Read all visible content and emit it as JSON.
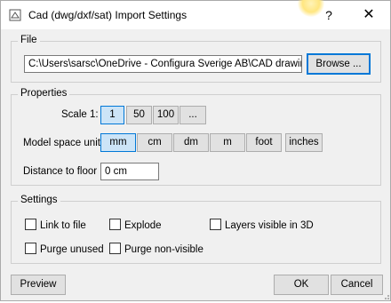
{
  "window": {
    "title": "Cad (dwg/dxf/sat) Import Settings",
    "help_label": "?",
    "close_label": "✕"
  },
  "file": {
    "group_label": "File",
    "path_value": "C:\\Users\\sarsc\\OneDrive - Configura Sverige AB\\CAD drawings",
    "browse_label": "Browse ..."
  },
  "properties": {
    "group_label": "Properties",
    "scale_label": "Scale 1:",
    "scale_options": [
      "1",
      "50",
      "100",
      "..."
    ],
    "scale_selected": "1",
    "unit_label": "Model space unit",
    "unit_options": [
      "mm",
      "cm",
      "dm",
      "m",
      "foot",
      "inches"
    ],
    "unit_selected": "mm",
    "distance_label": "Distance to floor",
    "distance_value": "0 cm"
  },
  "settings": {
    "group_label": "Settings",
    "link_to_file": "Link to file",
    "explode": "Explode",
    "layers_visible_3d": "Layers visible in 3D",
    "purge_unused": "Purge unused",
    "purge_non_visible": "Purge non-visible"
  },
  "footer": {
    "preview_label": "Preview",
    "ok_label": "OK",
    "cancel_label": "Cancel"
  },
  "colors": {
    "accent": "#0078d7",
    "selected_bg": "#cce4f7",
    "dialog_bg": "#f0f0f0"
  }
}
